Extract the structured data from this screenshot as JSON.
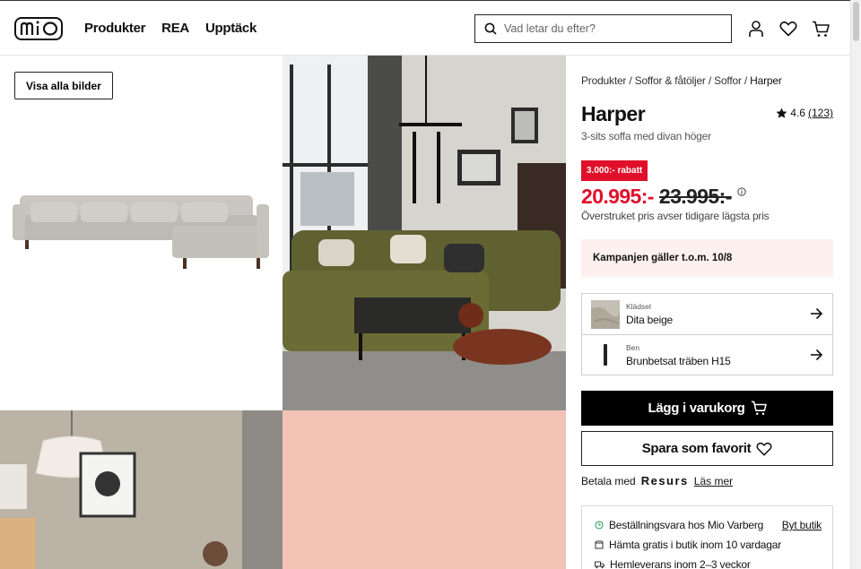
{
  "header": {
    "logo_text": "mio",
    "nav": [
      "Produkter",
      "REA",
      "Upptäck"
    ],
    "search_placeholder": "Vad letar du efter?",
    "icons": [
      "user-icon",
      "heart-icon",
      "cart-icon"
    ]
  },
  "gallery": {
    "show_all_label": "Visa alla bilder"
  },
  "product": {
    "breadcrumb": [
      "Produkter",
      "Soffor & fåtöljer",
      "Soffor",
      "Harper"
    ],
    "name": "Harper",
    "rating": "4.6",
    "review_count": "(123)",
    "subtitle": "3-sits soffa med divan höger",
    "discount_badge": "3.000:- rabatt",
    "price_now": "20.995:-",
    "price_old": "23.995:-",
    "price_note": "Överstruket pris avser tidigare lägsta pris",
    "campaign": "Kampanjen gäller t.o.m. 10/8",
    "options": [
      {
        "label": "Klädsel",
        "value": "Dita beige"
      },
      {
        "label": "Ben",
        "value": "Brunbetsat träben H15"
      }
    ],
    "add_to_cart": "Lägg i varukorg",
    "save_favorite": "Spara som favorit",
    "pay_with": "Betala med",
    "pay_provider": "Resurs",
    "read_more": "Läs mer",
    "delivery": [
      {
        "text": "Beställningsvara hos Mio Varberg",
        "action": "Byt butik"
      },
      {
        "text": "Hämta gratis i butik inom 10 vardagar"
      },
      {
        "text": "Hemleverans inom 2–3 veckor"
      }
    ]
  },
  "colors": {
    "sale_red": "#e0102a",
    "campaign_bg": "#fdf0ef",
    "black": "#000000"
  }
}
